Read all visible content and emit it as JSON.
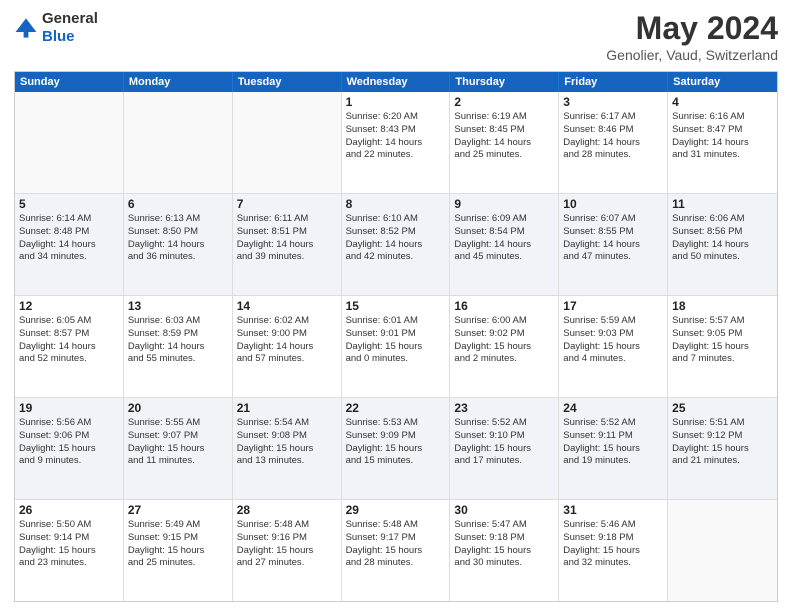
{
  "logo": {
    "general": "General",
    "blue": "Blue"
  },
  "header": {
    "title": "May 2024",
    "subtitle": "Genolier, Vaud, Switzerland"
  },
  "weekdays": [
    "Sunday",
    "Monday",
    "Tuesday",
    "Wednesday",
    "Thursday",
    "Friday",
    "Saturday"
  ],
  "rows": [
    [
      {
        "day": "",
        "empty": true
      },
      {
        "day": "",
        "empty": true
      },
      {
        "day": "",
        "empty": true
      },
      {
        "day": "1",
        "lines": [
          "Sunrise: 6:20 AM",
          "Sunset: 8:43 PM",
          "Daylight: 14 hours",
          "and 22 minutes."
        ]
      },
      {
        "day": "2",
        "lines": [
          "Sunrise: 6:19 AM",
          "Sunset: 8:45 PM",
          "Daylight: 14 hours",
          "and 25 minutes."
        ]
      },
      {
        "day": "3",
        "lines": [
          "Sunrise: 6:17 AM",
          "Sunset: 8:46 PM",
          "Daylight: 14 hours",
          "and 28 minutes."
        ]
      },
      {
        "day": "4",
        "lines": [
          "Sunrise: 6:16 AM",
          "Sunset: 8:47 PM",
          "Daylight: 14 hours",
          "and 31 minutes."
        ]
      }
    ],
    [
      {
        "day": "5",
        "lines": [
          "Sunrise: 6:14 AM",
          "Sunset: 8:48 PM",
          "Daylight: 14 hours",
          "and 34 minutes."
        ]
      },
      {
        "day": "6",
        "lines": [
          "Sunrise: 6:13 AM",
          "Sunset: 8:50 PM",
          "Daylight: 14 hours",
          "and 36 minutes."
        ]
      },
      {
        "day": "7",
        "lines": [
          "Sunrise: 6:11 AM",
          "Sunset: 8:51 PM",
          "Daylight: 14 hours",
          "and 39 minutes."
        ]
      },
      {
        "day": "8",
        "lines": [
          "Sunrise: 6:10 AM",
          "Sunset: 8:52 PM",
          "Daylight: 14 hours",
          "and 42 minutes."
        ]
      },
      {
        "day": "9",
        "lines": [
          "Sunrise: 6:09 AM",
          "Sunset: 8:54 PM",
          "Daylight: 14 hours",
          "and 45 minutes."
        ]
      },
      {
        "day": "10",
        "lines": [
          "Sunrise: 6:07 AM",
          "Sunset: 8:55 PM",
          "Daylight: 14 hours",
          "and 47 minutes."
        ]
      },
      {
        "day": "11",
        "lines": [
          "Sunrise: 6:06 AM",
          "Sunset: 8:56 PM",
          "Daylight: 14 hours",
          "and 50 minutes."
        ]
      }
    ],
    [
      {
        "day": "12",
        "lines": [
          "Sunrise: 6:05 AM",
          "Sunset: 8:57 PM",
          "Daylight: 14 hours",
          "and 52 minutes."
        ]
      },
      {
        "day": "13",
        "lines": [
          "Sunrise: 6:03 AM",
          "Sunset: 8:59 PM",
          "Daylight: 14 hours",
          "and 55 minutes."
        ]
      },
      {
        "day": "14",
        "lines": [
          "Sunrise: 6:02 AM",
          "Sunset: 9:00 PM",
          "Daylight: 14 hours",
          "and 57 minutes."
        ]
      },
      {
        "day": "15",
        "lines": [
          "Sunrise: 6:01 AM",
          "Sunset: 9:01 PM",
          "Daylight: 15 hours",
          "and 0 minutes."
        ]
      },
      {
        "day": "16",
        "lines": [
          "Sunrise: 6:00 AM",
          "Sunset: 9:02 PM",
          "Daylight: 15 hours",
          "and 2 minutes."
        ]
      },
      {
        "day": "17",
        "lines": [
          "Sunrise: 5:59 AM",
          "Sunset: 9:03 PM",
          "Daylight: 15 hours",
          "and 4 minutes."
        ]
      },
      {
        "day": "18",
        "lines": [
          "Sunrise: 5:57 AM",
          "Sunset: 9:05 PM",
          "Daylight: 15 hours",
          "and 7 minutes."
        ]
      }
    ],
    [
      {
        "day": "19",
        "lines": [
          "Sunrise: 5:56 AM",
          "Sunset: 9:06 PM",
          "Daylight: 15 hours",
          "and 9 minutes."
        ]
      },
      {
        "day": "20",
        "lines": [
          "Sunrise: 5:55 AM",
          "Sunset: 9:07 PM",
          "Daylight: 15 hours",
          "and 11 minutes."
        ]
      },
      {
        "day": "21",
        "lines": [
          "Sunrise: 5:54 AM",
          "Sunset: 9:08 PM",
          "Daylight: 15 hours",
          "and 13 minutes."
        ]
      },
      {
        "day": "22",
        "lines": [
          "Sunrise: 5:53 AM",
          "Sunset: 9:09 PM",
          "Daylight: 15 hours",
          "and 15 minutes."
        ]
      },
      {
        "day": "23",
        "lines": [
          "Sunrise: 5:52 AM",
          "Sunset: 9:10 PM",
          "Daylight: 15 hours",
          "and 17 minutes."
        ]
      },
      {
        "day": "24",
        "lines": [
          "Sunrise: 5:52 AM",
          "Sunset: 9:11 PM",
          "Daylight: 15 hours",
          "and 19 minutes."
        ]
      },
      {
        "day": "25",
        "lines": [
          "Sunrise: 5:51 AM",
          "Sunset: 9:12 PM",
          "Daylight: 15 hours",
          "and 21 minutes."
        ]
      }
    ],
    [
      {
        "day": "26",
        "lines": [
          "Sunrise: 5:50 AM",
          "Sunset: 9:14 PM",
          "Daylight: 15 hours",
          "and 23 minutes."
        ]
      },
      {
        "day": "27",
        "lines": [
          "Sunrise: 5:49 AM",
          "Sunset: 9:15 PM",
          "Daylight: 15 hours",
          "and 25 minutes."
        ]
      },
      {
        "day": "28",
        "lines": [
          "Sunrise: 5:48 AM",
          "Sunset: 9:16 PM",
          "Daylight: 15 hours",
          "and 27 minutes."
        ]
      },
      {
        "day": "29",
        "lines": [
          "Sunrise: 5:48 AM",
          "Sunset: 9:17 PM",
          "Daylight: 15 hours",
          "and 28 minutes."
        ]
      },
      {
        "day": "30",
        "lines": [
          "Sunrise: 5:47 AM",
          "Sunset: 9:18 PM",
          "Daylight: 15 hours",
          "and 30 minutes."
        ]
      },
      {
        "day": "31",
        "lines": [
          "Sunrise: 5:46 AM",
          "Sunset: 9:18 PM",
          "Daylight: 15 hours",
          "and 32 minutes."
        ]
      },
      {
        "day": "",
        "empty": true
      }
    ]
  ]
}
